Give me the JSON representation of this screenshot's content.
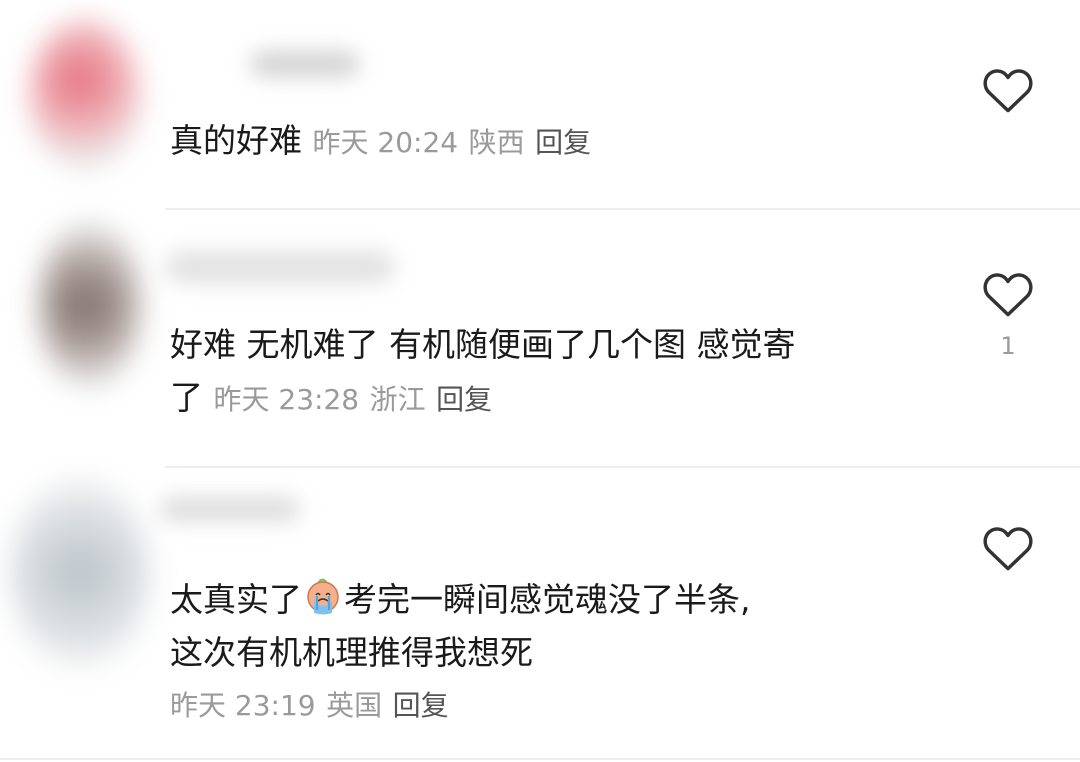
{
  "comments": [
    {
      "text": "真的好难",
      "time": "昨天 20:24",
      "location": "陕西",
      "reply_label": "回复",
      "likes": ""
    },
    {
      "text_line1": "好难 无机难了 有机随便画了几个图 感觉寄",
      "text_line2": "了",
      "time": "昨天 23:28",
      "location": "浙江",
      "reply_label": "回复",
      "likes": "1"
    },
    {
      "text_line1_pre": "太真实了",
      "emoji": "crying-face-emoji",
      "text_line1_post": "考完一瞬间感觉魂没了半条,",
      "text_line2": "这次有机机理推得我想死",
      "time": "昨天 23:19",
      "location": "英国",
      "reply_label": "回复",
      "likes": ""
    }
  ]
}
